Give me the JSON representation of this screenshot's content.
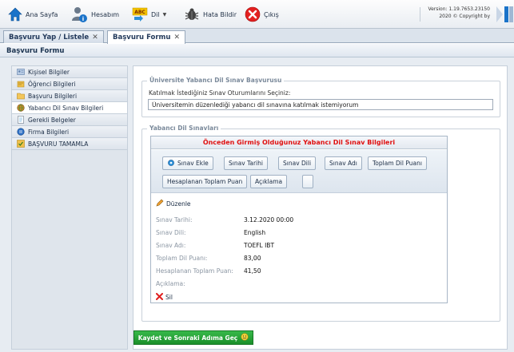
{
  "toolbar": {
    "home_label": "Ana Sayfa",
    "account_label": "Hesabım",
    "language_label": "Dil",
    "report_bug_label": "Hata Bildir",
    "exit_label": "Çıkış",
    "abc_text": "ABC",
    "version_line1": "Version: 1.19.7653.23150",
    "version_line2": "2020 © Copyright by"
  },
  "tabs": [
    {
      "label": "Başvuru Yap / Listele",
      "close": "✕"
    },
    {
      "label": "Başvuru Formu",
      "close": "✕"
    }
  ],
  "panel": {
    "title": "Başvuru Formu"
  },
  "sidebar": {
    "items": [
      {
        "label": "Kişisel Bilgiler",
        "icon": "person-card-icon"
      },
      {
        "label": "Öğrenci Bilgileri",
        "icon": "student-icon"
      },
      {
        "label": "Başvuru Bilgileri",
        "icon": "folder-icon"
      },
      {
        "label": "Yabancı Dil Sınav Bilgileri",
        "icon": "globe-icon"
      },
      {
        "label": "Gerekli Belgeler",
        "icon": "document-icon"
      },
      {
        "label": "Firma Bilgileri",
        "icon": "company-icon"
      },
      {
        "label": "BAŞVURU TAMAMLA",
        "icon": "complete-icon"
      }
    ]
  },
  "exam_application": {
    "legend": "Üniversite Yabancı Dil Sınav Başvurusu",
    "session_label": "Katılmak İstediğiniz Sınav Oturumlarını Seçiniz:",
    "session_value": "Üniversitemin düzenlediği yabancı dil sınavına katılmak istemiyorum"
  },
  "foreign_exams": {
    "legend": "Yabancı Dil Sınavları",
    "panel_title": "Önceden Girmiş Olduğunuz Yabancı Dil Sınav Bilgileri",
    "buttons": {
      "add": "Sınav Ekle",
      "date": "Sınav Tarihi",
      "language": "Sınav Dili",
      "name": "Sınav Adı",
      "total": "Toplam Dil Puanı",
      "computed": "Hesaplanan Toplam Puan",
      "description": "Açıklama"
    },
    "edit_label": "Düzenle",
    "delete_label": "Sil",
    "record": {
      "date_label": "Sınav Tarihi:",
      "date_value": "3.12.2020 00:00",
      "language_label": "Sınav Dili:",
      "language_value": "English",
      "name_label": "Sınav Adı:",
      "name_value": "TOEFL IBT",
      "total_label": "Toplam Dil Puanı:",
      "total_value": "83,00",
      "computed_label": "Hesaplanan Toplam Puan:",
      "computed_value": "41,50",
      "description_label": "Açıklama:",
      "description_value": ""
    }
  },
  "save_button": {
    "label": "Kaydet ve Sonraki Adıma Geç"
  },
  "colors": {
    "accent_red": "#e01010",
    "save_green": "#1a8f2a",
    "toolbar_blue": "#1f2f45"
  }
}
